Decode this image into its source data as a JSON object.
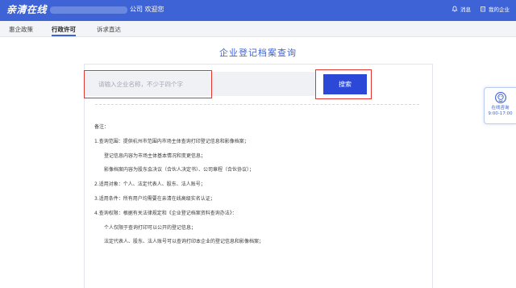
{
  "header": {
    "logo_text": "亲清在线",
    "welcome_text": "公司 欢迎您",
    "message_label": "消息",
    "my_company_label": "我的企业"
  },
  "nav": {
    "items": [
      {
        "label": "惠企政策"
      },
      {
        "label": "行政许可"
      },
      {
        "label": "诉求直达"
      }
    ],
    "active_index": 1
  },
  "main": {
    "title": "企业登记档案查询",
    "search": {
      "placeholder": "请输入企业名称，不少于四个字",
      "value": "",
      "button_label": "搜索"
    },
    "notes": [
      "备注：",
      "1.查询范围：提供杭州市范围内市场主体查询打印登记信息和影像档案；",
      "登记信息内容为市场主体基本情况和变更信息；",
      "影像档案内容为股东会决议（合伙人决定书）、公司章程（合伙协议）；",
      "2.适用对象：个人、法定代表人、股东、法人账号；",
      "3.适用条件：所有用户均需要在亲清在线高级实名认证；",
      "4.查询权限：根据有关法律规定和《企业登记档案资料查询办法》：",
      "个人仅限于查询打印可以公开的登记信息；",
      "法定代表人、股东、法人账号可以查询打印本企业的登记信息和影像档案；"
    ]
  },
  "service_widget": {
    "label": "在线咨询",
    "hours": "9:00-17:00"
  },
  "colors": {
    "brand_blue": "#3d63d6",
    "button_blue": "#2b49d6",
    "highlight_red": "#e3342f"
  }
}
